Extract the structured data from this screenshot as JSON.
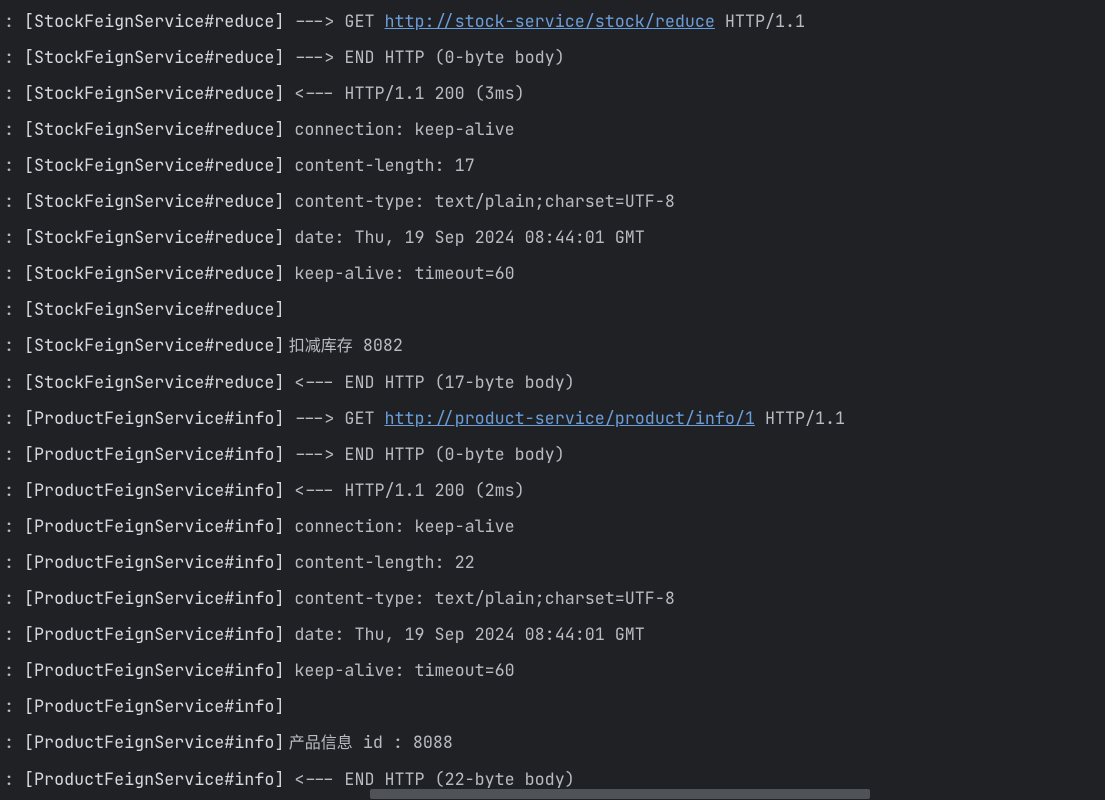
{
  "log": {
    "colon": ": ",
    "lines": [
      {
        "src": "[StockFeignService#reduce]",
        "pre": " ---> GET ",
        "url": "http://stock-service/stock/reduce",
        "post": " HTTP/1.1"
      },
      {
        "src": "[StockFeignService#reduce]",
        "pre": " ---> END HTTP (0-byte body)"
      },
      {
        "src": "[StockFeignService#reduce]",
        "pre": " <--- HTTP/1.1 200 (3ms)"
      },
      {
        "src": "[StockFeignService#reduce]",
        "pre": " connection: keep-alive"
      },
      {
        "src": "[StockFeignService#reduce]",
        "pre": " content-length: 17"
      },
      {
        "src": "[StockFeignService#reduce]",
        "pre": " content-type: text/plain;charset=UTF-8"
      },
      {
        "src": "[StockFeignService#reduce]",
        "pre": " date: Thu, 19 Sep 2024 08:44:01 GMT"
      },
      {
        "src": "[StockFeignService#reduce]",
        "pre": " keep-alive: timeout=60"
      },
      {
        "src": "[StockFeignService#reduce]",
        "pre": ""
      },
      {
        "src": "[StockFeignService#reduce]",
        "cjk": " 扣减库存",
        "pre": " 8082"
      },
      {
        "src": "[StockFeignService#reduce]",
        "pre": " <--- END HTTP (17-byte body)"
      },
      {
        "src": "[ProductFeignService#info]",
        "pre": " ---> GET ",
        "url": "http://product-service/product/info/1",
        "post": " HTTP/1.1"
      },
      {
        "src": "[ProductFeignService#info]",
        "pre": " ---> END HTTP (0-byte body)"
      },
      {
        "src": "[ProductFeignService#info]",
        "pre": " <--- HTTP/1.1 200 (2ms)"
      },
      {
        "src": "[ProductFeignService#info]",
        "pre": " connection: keep-alive"
      },
      {
        "src": "[ProductFeignService#info]",
        "pre": " content-length: 22"
      },
      {
        "src": "[ProductFeignService#info]",
        "pre": " content-type: text/plain;charset=UTF-8"
      },
      {
        "src": "[ProductFeignService#info]",
        "pre": " date: Thu, 19 Sep 2024 08:44:01 GMT"
      },
      {
        "src": "[ProductFeignService#info]",
        "pre": " keep-alive: timeout=60"
      },
      {
        "src": "[ProductFeignService#info]",
        "pre": ""
      },
      {
        "src": "[ProductFeignService#info]",
        "cjk": " 产品信息",
        "pre": " id : 8088"
      },
      {
        "src": "[ProductFeignService#info]",
        "pre": " <--- END HTTP (22-byte body)"
      }
    ]
  }
}
